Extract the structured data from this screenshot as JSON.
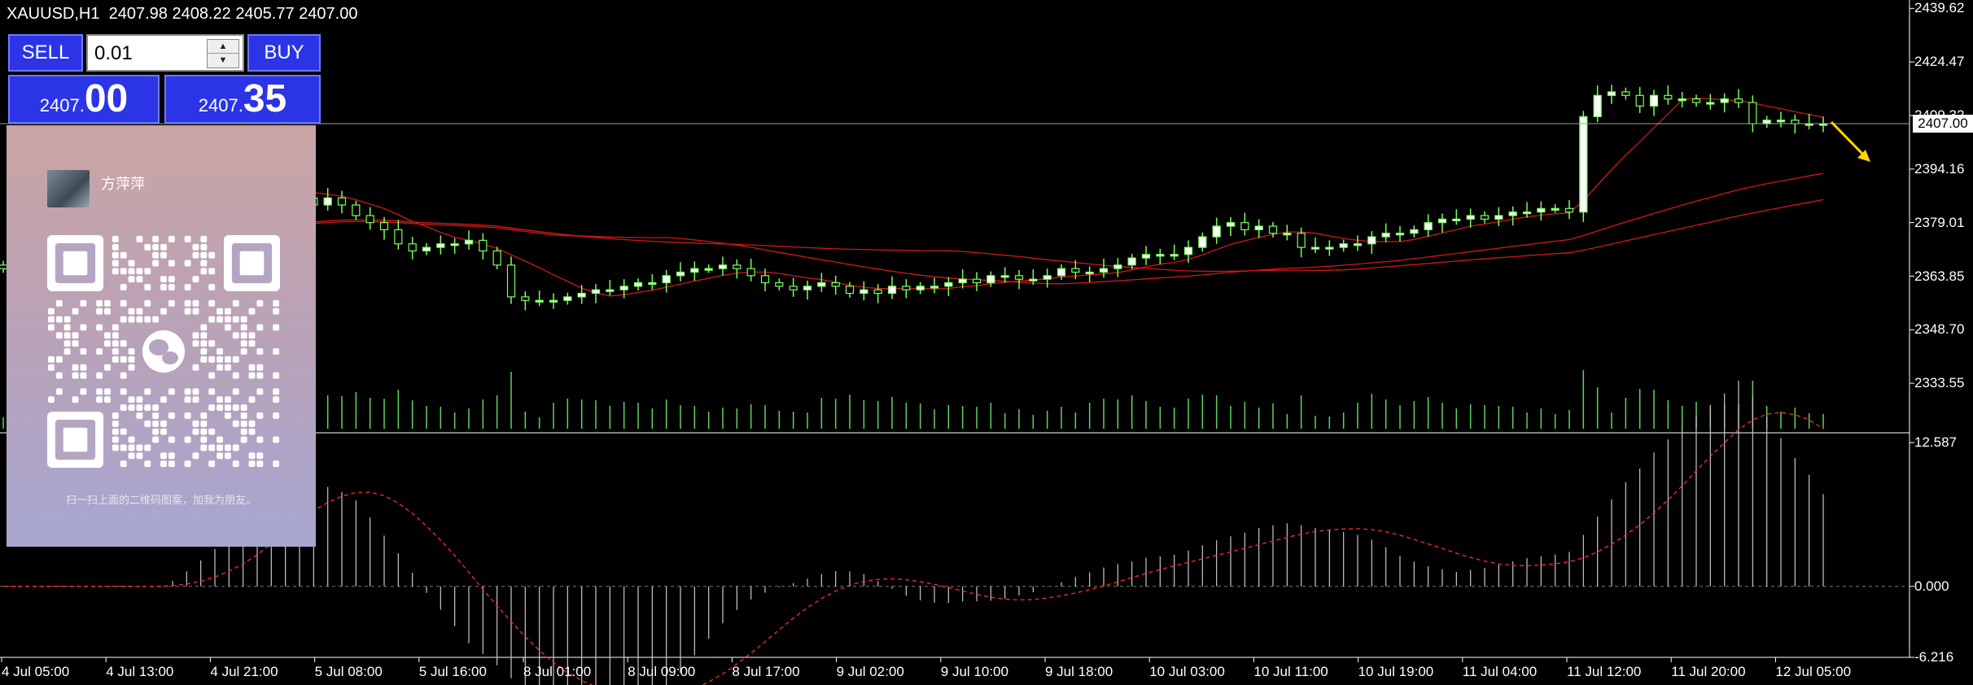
{
  "header": {
    "symbol_timeframe": "XAUUSD,H1",
    "ohlc": "2407.98 2408.22 2405.77 2407.00"
  },
  "trade_panel": {
    "sell_label": "SELL",
    "buy_label": "BUY",
    "lot_value": "0.01",
    "sell_price_small": "2407.",
    "sell_price_big": "00",
    "buy_price_small": "2407.",
    "buy_price_big": "35"
  },
  "qr_overlay": {
    "name": "方萍萍",
    "caption": "扫一扫上面的二维码图案，加我为朋友。"
  },
  "price_axis": {
    "labels": [
      "2439.62",
      "2424.47",
      "2409.32",
      "2394.16",
      "2379.01",
      "2363.85",
      "2348.70",
      "2333.55"
    ],
    "current_price": "2407.00"
  },
  "indicator_axis": {
    "labels": [
      "12.587",
      "0.000",
      "-6.216"
    ]
  },
  "time_axis": {
    "labels": [
      "4 Jul 05:00",
      "4 Jul 13:00",
      "4 Jul 21:00",
      "5 Jul 08:00",
      "5 Jul 16:00",
      "8 Jul 01:00",
      "8 Jul 09:00",
      "8 Jul 17:00",
      "9 Jul 02:00",
      "9 Jul 10:00",
      "9 Jul 18:00",
      "10 Jul 03:00",
      "10 Jul 11:00",
      "10 Jul 19:00",
      "11 Jul 04:00",
      "11 Jul 12:00",
      "11 Jul 20:00",
      "12 Jul 05:00"
    ]
  },
  "colors": {
    "background": "#000000",
    "bull_candle": "#ffffff",
    "bear_candle": "#000000",
    "candle_wick": "#7bff5e",
    "volume": "#5fd35f",
    "moving_average": "#d01818",
    "indicator_hist": "#c8c8c8",
    "signal_line": "#ff2a2a",
    "arrow": "#ffd700",
    "panel_button": "#2b34e6"
  },
  "chart_data": {
    "type": "candlestick",
    "symbol": "XAUUSD",
    "timeframe": "H1",
    "close_series": [
      2366,
      2364,
      2365,
      2366,
      2363,
      2365,
      2366,
      2361,
      2375,
      2382,
      2385,
      2386,
      2387,
      2389,
      2391,
      2390,
      2388,
      2389,
      2389,
      2387,
      2387,
      2386,
      2384,
      2386,
      2384,
      2381,
      2379,
      2377,
      2373,
      2371,
      2372,
      2373,
      2373,
      2374,
      2371,
      2367,
      2358,
      2357,
      2357,
      2357,
      2358,
      2359,
      2360,
      2360,
      2361,
      2362,
      2362,
      2364,
      2365,
      2366,
      2366,
      2367,
      2366,
      2364,
      2362,
      2361,
      2360,
      2361,
      2362,
      2361,
      2359,
      2360,
      2359,
      2361,
      2360,
      2361,
      2361,
      2362,
      2363,
      2362,
      2364,
      2364,
      2363,
      2363,
      2364,
      2366,
      2365,
      2365,
      2366,
      2367,
      2369,
      2370,
      2370,
      2370,
      2372,
      2375,
      2378,
      2379,
      2377,
      2378,
      2376,
      2376,
      2372,
      2372,
      2372,
      2373,
      2373,
      2375,
      2376,
      2376,
      2377,
      2379,
      2380,
      2380,
      2381,
      2380,
      2381,
      2382,
      2382,
      2383,
      2383,
      2382,
      2409,
      2415,
      2416,
      2415,
      2412,
      2415,
      2414,
      2414,
      2413,
      2413,
      2414,
      2413,
      2407,
      2408,
      2408,
      2407,
      2407,
      2407
    ],
    "price_ticks": [
      2439.62,
      2424.47,
      2409.32,
      2394.16,
      2379.01,
      2363.85,
      2348.7,
      2333.55
    ],
    "current_price": 2407.0,
    "indicator": {
      "ticks": [
        12.587,
        0.0,
        -6.216
      ]
    }
  }
}
